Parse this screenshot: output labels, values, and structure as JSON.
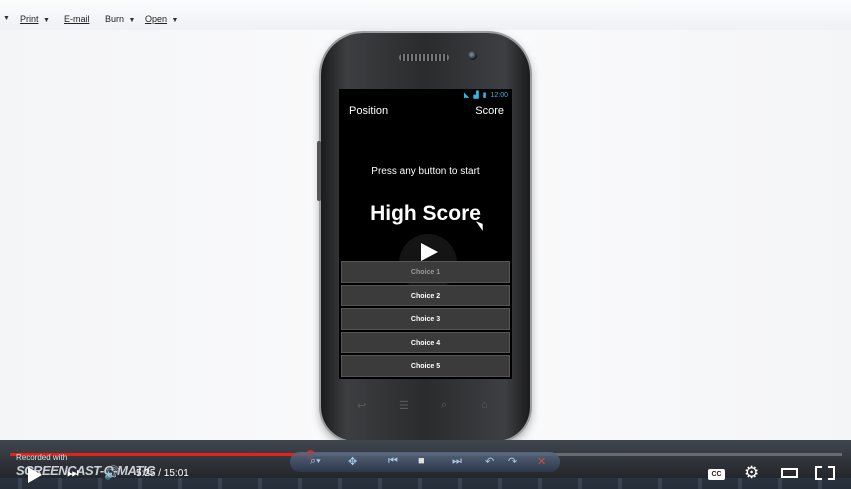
{
  "toolbar": {
    "items": [
      {
        "label": "Print",
        "icon": "printer-icon"
      },
      {
        "label": "E-mail",
        "icon": "email-icon"
      },
      {
        "label": "Burn",
        "icon": "disc-icon"
      },
      {
        "label": "Open",
        "icon": "open-icon"
      }
    ]
  },
  "phone": {
    "status": {
      "time": "12:00"
    },
    "header": {
      "position_label": "Position",
      "score_label": "Score"
    },
    "start_message": "Press any button to start",
    "high_score_title": "High Score",
    "choices": [
      "Choice 1",
      "Choice 2",
      "Choice 3",
      "Choice 4",
      "Choice 5"
    ]
  },
  "player": {
    "recorded_with": "Recorded with",
    "brand": "SCREENCAST-O-MATIC",
    "current_time": "5:25",
    "duration": "15:01",
    "time_display": "5:25 / 15:01",
    "progress": 0.361,
    "cc_label": "CC",
    "accent_color": "#e62117"
  }
}
